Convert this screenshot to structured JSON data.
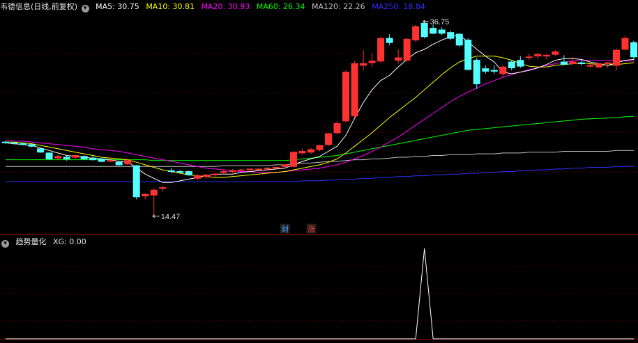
{
  "main_panel": {
    "stock_name": "韦德信息",
    "period": "(日线,前复权)",
    "ma_labels": [
      {
        "name": "MA5",
        "value": "30.75",
        "color": "#ffffff"
      },
      {
        "name": "MA10",
        "value": "30.81",
        "color": "#ffff00"
      },
      {
        "name": "MA20",
        "value": "30.93",
        "color": "#ff00ff"
      },
      {
        "name": "MA60",
        "value": "26.34",
        "color": "#00ff00"
      },
      {
        "name": "MA120",
        "value": "22.26",
        "color": "#c0c0c0"
      },
      {
        "name": "MA250",
        "value": "18.84",
        "color": "#3030ff"
      }
    ],
    "high_label": "36.75",
    "low_label": "14.47",
    "event_badges": [
      {
        "text": "财",
        "color": "#4fa3ff"
      },
      {
        "text": "涨",
        "color": "#ff4040"
      }
    ]
  },
  "indicator_panel": {
    "name": "趋势量化",
    "xg_label": "XG: 0.00"
  },
  "colors": {
    "background": "#000000",
    "up": "#ff3232",
    "down": "#54ffff",
    "grid": "#8b0000",
    "border": "#b00000",
    "xg_line": "#ffffff"
  },
  "chart_data": [
    {
      "type": "candlestick",
      "price_range": [
        12.5,
        38.5
      ],
      "candles": [
        [
          23.3,
          23.4,
          23.1,
          23.2
        ],
        [
          23.2,
          23.3,
          23.0,
          23.1
        ],
        [
          23.1,
          23.2,
          22.9,
          23.0
        ],
        [
          23.0,
          23.1,
          22.7,
          22.8
        ],
        [
          22.5,
          22.6,
          22.0,
          22.1
        ],
        [
          22.0,
          22.1,
          21.2,
          21.3
        ],
        [
          21.4,
          21.8,
          21.2,
          21.6
        ],
        [
          21.5,
          21.7,
          21.1,
          21.3
        ],
        [
          21.5,
          21.8,
          21.3,
          21.7
        ],
        [
          21.6,
          21.7,
          21.2,
          21.3
        ],
        [
          21.4,
          21.6,
          21.1,
          21.2
        ],
        [
          21.3,
          21.4,
          20.9,
          21.0
        ],
        [
          21.1,
          21.2,
          20.9,
          21.1
        ],
        [
          20.9,
          21.0,
          20.5,
          20.6
        ],
        [
          20.7,
          21.3,
          20.6,
          21.1
        ],
        [
          20.5,
          20.6,
          16.5,
          16.8
        ],
        [
          16.9,
          17.2,
          16.5,
          17.1
        ],
        [
          17.0,
          17.8,
          14.5,
          17.6
        ],
        [
          17.8,
          18.1,
          17.4,
          17.9
        ],
        [
          19.9,
          20.2,
          19.6,
          19.8
        ],
        [
          19.8,
          20.0,
          19.6,
          19.7
        ],
        [
          19.8,
          19.9,
          19.3,
          19.4
        ],
        [
          19.0,
          19.5,
          18.8,
          19.3
        ],
        [
          19.2,
          19.5,
          19.0,
          19.4
        ],
        [
          19.4,
          19.6,
          19.2,
          19.5
        ],
        [
          19.7,
          20.0,
          19.5,
          19.8
        ],
        [
          19.8,
          20.1,
          19.6,
          19.9
        ],
        [
          20.0,
          20.1,
          19.8,
          20.0
        ],
        [
          20.0,
          20.1,
          19.9,
          20.1
        ],
        [
          20.1,
          20.2,
          20.0,
          20.1
        ],
        [
          20.1,
          20.3,
          20.0,
          20.2
        ],
        [
          20.2,
          20.4,
          20.1,
          20.3
        ],
        [
          20.4,
          20.7,
          20.3,
          20.6
        ],
        [
          20.4,
          22.2,
          20.3,
          22.1
        ],
        [
          22.0,
          22.5,
          21.8,
          22.2
        ],
        [
          22.1,
          22.6,
          21.9,
          22.4
        ],
        [
          22.4,
          23.0,
          22.2,
          22.9
        ],
        [
          23.0,
          24.4,
          22.8,
          24.3
        ],
        [
          24.4,
          25.8,
          24.2,
          25.5
        ],
        [
          25.8,
          31.8,
          25.6,
          31.6
        ],
        [
          26.4,
          32.9,
          26.2,
          32.6
        ],
        [
          32.4,
          34.2,
          31.8,
          32.6
        ],
        [
          32.7,
          33.8,
          32.2,
          32.9
        ],
        [
          32.9,
          35.8,
          32.7,
          35.6
        ],
        [
          35.6,
          36.1,
          34.8,
          35.1
        ],
        [
          33.0,
          34.3,
          32.6,
          33.3
        ],
        [
          33.0,
          35.7,
          32.8,
          35.5
        ],
        [
          35.4,
          37.2,
          35.2,
          37.0
        ],
        [
          37.4,
          37.6,
          35.6,
          35.8
        ],
        [
          36.8,
          37.2,
          36.1,
          36.2
        ],
        [
          36.6,
          36.9,
          36.0,
          36.2
        ],
        [
          36.3,
          36.5,
          35.4,
          35.6
        ],
        [
          36.1,
          36.2,
          34.6,
          34.8
        ],
        [
          35.4,
          35.6,
          31.8,
          31.9
        ],
        [
          33.0,
          33.3,
          29.6,
          30.2
        ],
        [
          32.0,
          32.4,
          31.4,
          31.7
        ],
        [
          31.8,
          32.4,
          31.4,
          31.7
        ],
        [
          31.4,
          32.4,
          31.0,
          32.2
        ],
        [
          32.8,
          33.0,
          31.8,
          32.1
        ],
        [
          33.0,
          33.5,
          32.1,
          32.3
        ],
        [
          33.4,
          33.8,
          33.0,
          33.4
        ],
        [
          33.5,
          33.8,
          33.1,
          33.7
        ],
        [
          33.5,
          33.8,
          33.1,
          33.6
        ],
        [
          33.7,
          34.2,
          33.5,
          34.0
        ],
        [
          32.8,
          33.6,
          32.4,
          32.5
        ],
        [
          32.6,
          33.4,
          32.4,
          32.8
        ],
        [
          32.7,
          33.0,
          32.4,
          32.6
        ],
        [
          32.3,
          32.6,
          32.1,
          32.4
        ],
        [
          32.2,
          32.7,
          32.1,
          32.6
        ],
        [
          32.6,
          32.8,
          32.1,
          32.7
        ],
        [
          32.4,
          34.4,
          31.8,
          34.2
        ],
        [
          34.3,
          35.9,
          34.2,
          35.6
        ],
        [
          35.1,
          35.3,
          33.0,
          33.4
        ]
      ],
      "ma5": [
        23.2,
        23.1,
        23.0,
        22.9,
        22.6,
        22.3,
        22.0,
        21.7,
        21.6,
        21.5,
        21.4,
        21.3,
        21.2,
        21.0,
        21.0,
        20.2,
        19.5,
        19.0,
        18.5,
        18.5,
        18.7,
        18.9,
        19.1,
        19.3,
        19.5,
        19.5,
        19.5,
        19.7,
        19.8,
        19.9,
        20.0,
        20.1,
        20.2,
        20.6,
        21.0,
        21.3,
        21.6,
        22.2,
        22.8,
        24.1,
        26.1,
        28.0,
        29.5,
        30.6,
        31.2,
        32.2,
        33.1,
        33.9,
        34.3,
        34.9,
        35.4,
        35.8,
        36.0,
        35.2,
        34.3,
        33.5,
        32.8,
        31.6,
        31.4,
        31.6,
        31.8,
        32.1,
        32.5,
        33.0,
        33.2,
        33.2,
        33.1,
        32.8,
        32.6,
        32.4,
        32.7,
        33.0,
        33.1
      ],
      "ma10": [
        23.3,
        23.3,
        23.2,
        23.1,
        22.9,
        22.7,
        22.5,
        22.3,
        22.1,
        21.9,
        21.7,
        21.5,
        21.4,
        21.3,
        21.2,
        20.9,
        20.6,
        20.3,
        20.0,
        19.8,
        19.6,
        19.4,
        19.3,
        19.2,
        19.1,
        19.1,
        19.2,
        19.3,
        19.4,
        19.5,
        19.6,
        19.7,
        19.8,
        20.0,
        20.2,
        20.4,
        20.6,
        20.9,
        21.3,
        22.0,
        22.8,
        23.6,
        24.4,
        25.3,
        26.2,
        27.0,
        27.8,
        28.6,
        29.5,
        30.4,
        31.3,
        32.1,
        32.8,
        33.2,
        33.5,
        33.5,
        33.5,
        33.3,
        33.0,
        32.6,
        32.3,
        32.2,
        32.2,
        32.4,
        32.5,
        32.6,
        32.7,
        32.6,
        32.5,
        32.4,
        32.5,
        32.6,
        32.7
      ],
      "ma20": [
        23.5,
        23.4,
        23.4,
        23.3,
        23.2,
        23.1,
        23.0,
        22.9,
        22.8,
        22.7,
        22.5,
        22.4,
        22.3,
        22.2,
        22.0,
        21.8,
        21.6,
        21.4,
        21.2,
        21.0,
        20.8,
        20.6,
        20.4,
        20.2,
        20.1,
        20.0,
        19.9,
        19.8,
        19.8,
        19.7,
        19.7,
        19.7,
        19.8,
        19.9,
        20.0,
        20.1,
        20.2,
        20.4,
        20.6,
        20.9,
        21.3,
        21.7,
        22.2,
        22.7,
        23.3,
        23.9,
        24.6,
        25.3,
        26.0,
        26.7,
        27.4,
        28.1,
        28.7,
        29.2,
        29.7,
        30.2,
        30.6,
        31.0,
        31.3,
        31.6,
        31.9,
        32.1,
        32.4,
        32.6,
        32.8,
        32.9,
        33.0,
        33.0,
        33.0,
        33.0,
        33.0,
        32.9,
        32.9
      ],
      "ma60": [
        21.2,
        21.2,
        21.2,
        21.2,
        21.2,
        21.2,
        21.2,
        21.2,
        21.2,
        21.2,
        21.2,
        21.2,
        21.2,
        21.2,
        21.2,
        21.2,
        21.2,
        21.1,
        21.1,
        21.1,
        21.1,
        21.1,
        21.1,
        21.1,
        21.1,
        21.1,
        21.1,
        21.1,
        21.1,
        21.1,
        21.1,
        21.1,
        21.1,
        21.2,
        21.3,
        21.4,
        21.5,
        21.6,
        21.7,
        21.9,
        22.1,
        22.3,
        22.5,
        22.7,
        22.9,
        23.1,
        23.3,
        23.5,
        23.7,
        23.9,
        24.1,
        24.3,
        24.5,
        24.7,
        24.8,
        24.9,
        25.0,
        25.1,
        25.2,
        25.3,
        25.4,
        25.5,
        25.6,
        25.7,
        25.8,
        25.9,
        26.0,
        26.05,
        26.1,
        26.15,
        26.2,
        26.3,
        26.34
      ],
      "ma120": [
        20.4,
        20.4,
        20.4,
        20.4,
        20.4,
        20.4,
        20.4,
        20.4,
        20.4,
        20.4,
        20.4,
        20.4,
        20.4,
        20.4,
        20.4,
        20.4,
        20.4,
        20.4,
        20.4,
        20.4,
        20.4,
        20.4,
        20.4,
        20.4,
        20.4,
        20.5,
        20.5,
        20.5,
        20.5,
        20.5,
        20.5,
        20.6,
        20.6,
        20.7,
        20.8,
        20.8,
        20.9,
        21.0,
        21.0,
        21.1,
        21.2,
        21.2,
        21.3,
        21.3,
        21.4,
        21.5,
        21.5,
        21.6,
        21.6,
        21.7,
        21.7,
        21.8,
        21.8,
        21.8,
        21.9,
        21.9,
        21.9,
        22.0,
        22.0,
        22.0,
        22.1,
        22.1,
        22.1,
        22.1,
        22.2,
        22.2,
        22.2,
        22.2,
        22.2,
        22.2,
        22.3,
        22.3,
        22.3
      ],
      "ma250": [
        18.6,
        18.6,
        18.6,
        18.6,
        18.6,
        18.6,
        18.6,
        18.6,
        18.6,
        18.6,
        18.6,
        18.6,
        18.6,
        18.6,
        18.6,
        18.6,
        18.6,
        18.6,
        18.6,
        18.6,
        18.6,
        18.6,
        18.6,
        18.6,
        18.6,
        18.6,
        18.6,
        18.6,
        18.6,
        18.6,
        18.6,
        18.6,
        18.6,
        18.6,
        18.7,
        18.7,
        18.7,
        18.8,
        18.8,
        18.9,
        18.9,
        19.0,
        19.0,
        19.1,
        19.1,
        19.2,
        19.2,
        19.3,
        19.3,
        19.4,
        19.4,
        19.5,
        19.5,
        19.6,
        19.6,
        19.7,
        19.7,
        19.8,
        19.8,
        19.9,
        19.9,
        20.0,
        20.0,
        20.1,
        20.1,
        20.2,
        20.2,
        20.3,
        20.3,
        20.3,
        20.4,
        20.4,
        20.4
      ]
    },
    {
      "type": "line",
      "name": "XG",
      "ylim": [
        0,
        1
      ],
      "values": [
        0,
        0,
        0,
        0,
        0,
        0,
        0,
        0,
        0,
        0,
        0,
        0,
        0,
        0,
        0,
        0,
        0,
        0,
        0,
        0,
        0,
        0,
        0,
        0,
        0,
        0,
        0,
        0,
        0,
        0,
        0,
        0,
        0,
        0,
        0,
        0,
        0,
        0,
        0,
        0,
        0,
        0,
        0,
        0,
        0,
        0,
        0,
        0,
        1,
        0,
        0,
        0,
        0,
        0,
        0,
        0,
        0,
        0,
        0,
        0,
        0,
        0,
        0,
        0,
        0,
        0,
        0,
        0,
        0,
        0,
        0,
        0,
        0
      ]
    }
  ]
}
